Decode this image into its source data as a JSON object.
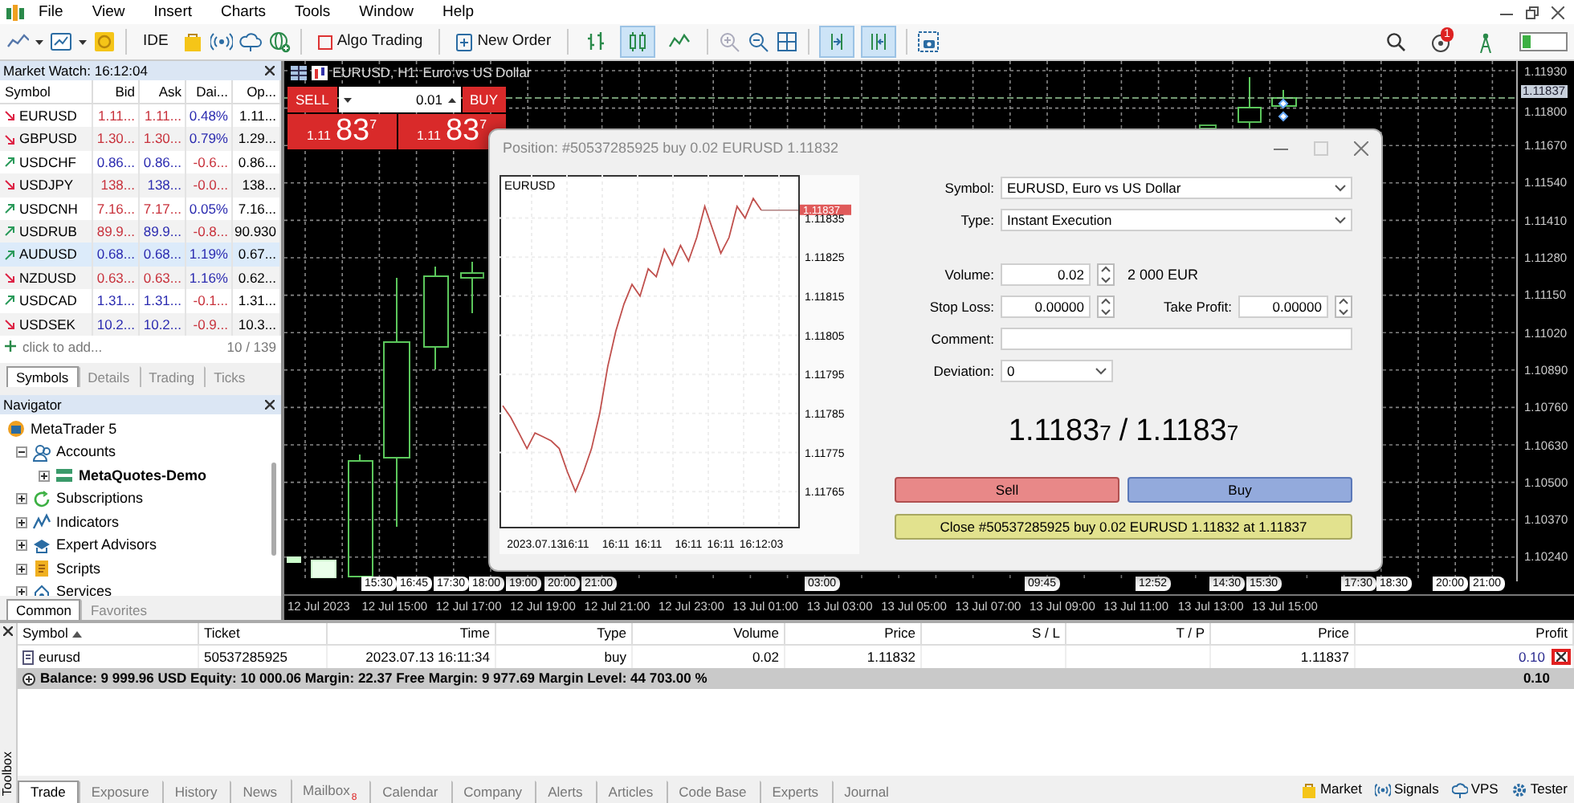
{
  "menu": [
    "File",
    "View",
    "Insert",
    "Charts",
    "Tools",
    "Window",
    "Help"
  ],
  "toolbar": {
    "ide": "IDE",
    "algo_trading": "Algo Trading",
    "new_order": "New Order",
    "chart_types": [
      {
        "selected": false
      },
      {
        "selected": true
      },
      {
        "selected": false
      }
    ],
    "autoscroll": {
      "on": true
    },
    "chart_shift": {
      "on": true
    },
    "notifications": "1"
  },
  "market_watch": {
    "title": "Market Watch: 16:12:04",
    "columns": [
      "Symbol",
      "Bid",
      "Ask",
      "Dai...",
      "Op..."
    ],
    "rows": [
      {
        "symbol": "EURUSD",
        "rising": false,
        "bid": {
          "text": "1.11...",
          "color": "#c8323c"
        },
        "ask": {
          "text": "1.11...",
          "color": "#c8323c"
        },
        "daily": {
          "text": "0.48%",
          "color": "#2b2bb0"
        },
        "open": "1.11...",
        "selected": false
      },
      {
        "symbol": "GBPUSD",
        "rising": false,
        "bid": {
          "text": "1.30...",
          "color": "#c8323c"
        },
        "ask": {
          "text": "1.30...",
          "color": "#c8323c"
        },
        "daily": {
          "text": "0.79%",
          "color": "#2b2bb0"
        },
        "open": "1.29...",
        "selected": false
      },
      {
        "symbol": "USDCHF",
        "rising": true,
        "bid": {
          "text": "0.86...",
          "color": "#2b2bb0"
        },
        "ask": {
          "text": "0.86...",
          "color": "#2b2bb0"
        },
        "daily": {
          "text": "-0.6...",
          "color": "#c8323c"
        },
        "open": "0.86...",
        "selected": false
      },
      {
        "symbol": "USDJPY",
        "rising": false,
        "bid": {
          "text": "138...",
          "color": "#c8323c"
        },
        "ask": {
          "text": "138...",
          "color": "#2b2bb0"
        },
        "daily": {
          "text": "-0.0...",
          "color": "#c8323c"
        },
        "open": "138...",
        "selected": false
      },
      {
        "symbol": "USDCNH",
        "rising": true,
        "bid": {
          "text": "7.16...",
          "color": "#c8323c"
        },
        "ask": {
          "text": "7.17...",
          "color": "#c8323c"
        },
        "daily": {
          "text": "0.05%",
          "color": "#2b2bb0"
        },
        "open": "7.16...",
        "selected": false
      },
      {
        "symbol": "USDRUB",
        "rising": true,
        "bid": {
          "text": "89.9...",
          "color": "#c8323c"
        },
        "ask": {
          "text": "89.9...",
          "color": "#2b2bb0"
        },
        "daily": {
          "text": "-0.8...",
          "color": "#c8323c"
        },
        "open": "90.930",
        "selected": false
      },
      {
        "symbol": "AUDUSD",
        "rising": true,
        "bid": {
          "text": "0.68...",
          "color": "#2b2bb0"
        },
        "ask": {
          "text": "0.68...",
          "color": "#2b2bb0"
        },
        "daily": {
          "text": "1.19%",
          "color": "#2b2bb0"
        },
        "open": "0.67...",
        "selected": true
      },
      {
        "symbol": "NZDUSD",
        "rising": false,
        "bid": {
          "text": "0.63...",
          "color": "#c8323c"
        },
        "ask": {
          "text": "0.63...",
          "color": "#c8323c"
        },
        "daily": {
          "text": "1.16%",
          "color": "#2b2bb0"
        },
        "open": "0.62...",
        "selected": false
      },
      {
        "symbol": "USDCAD",
        "rising": true,
        "bid": {
          "text": "1.31...",
          "color": "#2b2bb0"
        },
        "ask": {
          "text": "1.31...",
          "color": "#2b2bb0"
        },
        "daily": {
          "text": "-0.1...",
          "color": "#c8323c"
        },
        "open": "1.31...",
        "selected": false
      },
      {
        "symbol": "USDSEK",
        "rising": false,
        "bid": {
          "text": "10.2...",
          "color": "#2b2bb0"
        },
        "ask": {
          "text": "10.2...",
          "color": "#2b2bb0"
        },
        "daily": {
          "text": "-0.9...",
          "color": "#c8323c"
        },
        "open": "10.3...",
        "selected": false
      }
    ],
    "add_placeholder": "click to add...",
    "count": "10 / 139",
    "tabs": [
      {
        "label": "Symbols",
        "selected": true
      },
      {
        "label": "Details",
        "selected": false
      },
      {
        "label": "Trading",
        "selected": false
      },
      {
        "label": "Ticks",
        "selected": false
      }
    ]
  },
  "navigator": {
    "title": "Navigator",
    "root": "MetaTrader 5",
    "items": [
      {
        "kind": "accounts",
        "label": "Accounts",
        "expanded": true,
        "children": [
          {
            "kind": "server",
            "label": "MetaQuotes-Demo",
            "expanded": false
          }
        ]
      },
      {
        "kind": "subscriptions",
        "label": "Subscriptions",
        "expanded": false
      },
      {
        "kind": "indicators",
        "label": "Indicators",
        "expanded": false
      },
      {
        "kind": "experts",
        "label": "Expert Advisors",
        "expanded": false
      },
      {
        "kind": "scripts",
        "label": "Scripts",
        "expanded": false
      },
      {
        "kind": "services",
        "label": "Services",
        "expanded": false
      }
    ],
    "tabs": [
      {
        "label": "Common",
        "selected": true
      },
      {
        "label": "Favorites",
        "selected": false
      }
    ]
  },
  "chart": {
    "title": "EURUSD, H1: Euro vs US Dollar",
    "one_click": {
      "sell": "SELL",
      "buy": "BUY",
      "volume": "0.01",
      "sell_price": {
        "big": "1.11",
        "pips": "83",
        "point": "7"
      },
      "buy_price": {
        "big": "1.11",
        "pips": "83",
        "point": "7"
      }
    },
    "price_labels": [
      "1.11930",
      "1.11800",
      "1.11670",
      "1.11540",
      "1.11410",
      "1.11280",
      "1.11150",
      "1.11020",
      "1.10890",
      "1.10760",
      "1.10630",
      "1.10500",
      "1.10370",
      "1.10240"
    ],
    "current_price": "1.11837",
    "time_tags": [
      "15:30",
      "16:45",
      "17:30",
      "18:00",
      "19:00",
      "20:00",
      "21:00",
      "03:00",
      "09:45",
      "12:52",
      "14:30",
      "15:30",
      "17:30",
      "18:30",
      "20:00",
      "21:00"
    ],
    "date_labels": [
      "12 Jul 2023",
      "12 Jul 15:00",
      "12 Jul 17:00",
      "12 Jul 19:00",
      "12 Jul 21:00",
      "12 Jul 23:00",
      "13 Jul 01:00",
      "13 Jul 03:00",
      "13 Jul 05:00",
      "13 Jul 07:00",
      "13 Jul 09:00",
      "13 Jul 11:00",
      "13 Jul 13:00",
      "13 Jul 15:00"
    ]
  },
  "dialog": {
    "title": "Position: #50537285925 buy 0.02 EURUSD 1.11832",
    "tick_chart": {
      "price_tag": "1.11837",
      "chart_data": {
        "type": "line",
        "title": "EURUSD",
        "categories": [
          null,
          null,
          null,
          null,
          "2023.07.13",
          null,
          null,
          null,
          null,
          "16:11",
          null,
          null,
          null,
          null,
          "16:11",
          null,
          null,
          null,
          "16:11",
          null,
          null,
          null,
          null,
          "16:11",
          null,
          null,
          null,
          "16:11",
          null,
          null,
          null,
          null,
          "16:12:03"
        ],
        "series": [
          {
            "color": "#c0504d",
            "values": [
              1.11787,
              1.11784,
              1.1178,
              1.11776,
              1.1178,
              1.11779,
              1.11778,
              1.11776,
              1.1177,
              1.11765,
              1.1177,
              1.11776,
              1.11785,
              1.11797,
              1.11806,
              1.11813,
              1.11818,
              1.11815,
              1.11822,
              1.1182,
              1.11827,
              1.11823,
              1.11828,
              1.11824,
              1.1183,
              1.11838,
              1.11832,
              1.11826,
              1.1183,
              1.11838,
              1.11835,
              1.1184,
              1.11837
            ]
          }
        ],
        "ylim": [
          1.11756,
          1.11846
        ],
        "yticks": [
          1.11835,
          1.11825,
          1.11815,
          1.11805,
          1.11795,
          1.11785,
          1.11775,
          1.11765
        ],
        "grid": true
      }
    },
    "symbol": {
      "label": "Symbol:",
      "value": "EURUSD, Euro vs US Dollar"
    },
    "type": {
      "label": "Type:",
      "value": "Instant Execution"
    },
    "volume": {
      "label": "Volume:",
      "value": "0.02",
      "note": "2 000 EUR"
    },
    "stop_loss": {
      "label": "Stop Loss:",
      "value": "0.00000"
    },
    "take_profit": {
      "label": "Take Profit:",
      "value": "0.00000"
    },
    "comment": {
      "label": "Comment:"
    },
    "deviation": {
      "label": "Deviation:",
      "value": "0"
    },
    "quote": {
      "bid": "1.1183",
      "bid_point": "7",
      "separator": "/",
      "ask": "1.1183",
      "ask_point": "7"
    },
    "sell": "Sell",
    "buy": "Buy",
    "close": "Close #50537285925 buy 0.02 EURUSD 1.11832 at 1.11837"
  },
  "toolbox": {
    "title": "Toolbox",
    "columns": [
      "Symbol",
      "Ticket",
      "Time",
      "Type",
      "Volume",
      "Price",
      "S / L",
      "T / P",
      "Price",
      "Profit"
    ],
    "positions": [
      {
        "symbol": "eurusd",
        "ticket": "50537285925",
        "time": "2023.07.13 16:11:34",
        "type": "buy",
        "volume": "0.02",
        "open_price": "1.11832",
        "price": "1.11837",
        "profit": "0.10"
      }
    ],
    "summary": {
      "text": "Balance: 9 999.96 USD  Equity: 10 000.06  Margin: 22.37  Free Margin: 9 977.69  Margin Level: 44 703.00 %",
      "profit": "0.10"
    },
    "tabs": [
      {
        "label": "Trade",
        "selected": true
      },
      {
        "label": "Exposure",
        "selected": false
      },
      {
        "label": "History",
        "selected": false
      },
      {
        "label": "News",
        "selected": false
      },
      {
        "label": "Mailbox",
        "selected": false,
        "badge": "8"
      },
      {
        "label": "Calendar",
        "selected": false
      },
      {
        "label": "Company",
        "selected": false
      },
      {
        "label": "Alerts",
        "selected": false
      },
      {
        "label": "Articles",
        "selected": false
      },
      {
        "label": "Code Base",
        "selected": false
      },
      {
        "label": "Experts",
        "selected": false
      },
      {
        "label": "Journal",
        "selected": false
      }
    ],
    "services": [
      {
        "kind": "market",
        "label": "Market"
      },
      {
        "kind": "signals",
        "label": "Signals"
      },
      {
        "kind": "vps",
        "label": "VPS"
      },
      {
        "kind": "tester",
        "label": "Tester"
      }
    ]
  }
}
